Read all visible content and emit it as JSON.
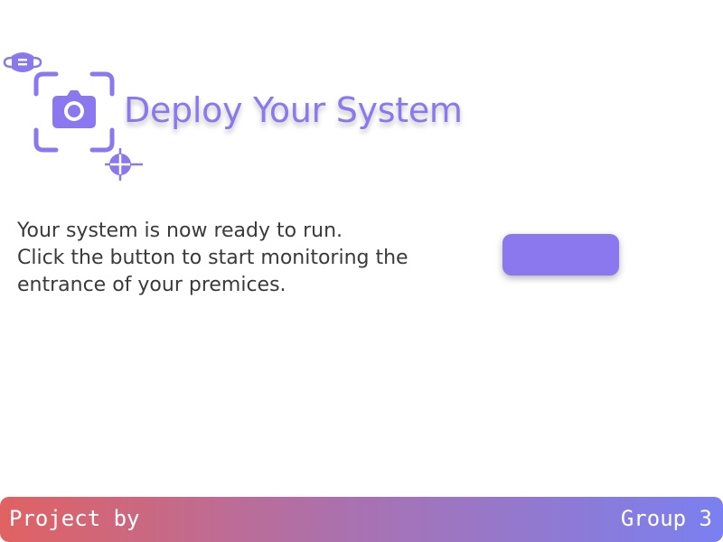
{
  "header": {
    "title": "Deploy Your System",
    "logo_icons": [
      "mask-icon",
      "camera-icon",
      "crosshair-icon"
    ]
  },
  "main": {
    "description_lines": [
      "Your system is now ready to run.",
      "Click the button to start monitoring the",
      "entrance of your premices."
    ],
    "run_button_label": ""
  },
  "footer": {
    "left_text": "Project by",
    "right_text": "Group 3"
  },
  "colors": {
    "accent": "#8b78ee",
    "footer_gradient": [
      "#e06262",
      "#a872b2",
      "#7a80f0"
    ],
    "text": "#3a3a3a"
  }
}
